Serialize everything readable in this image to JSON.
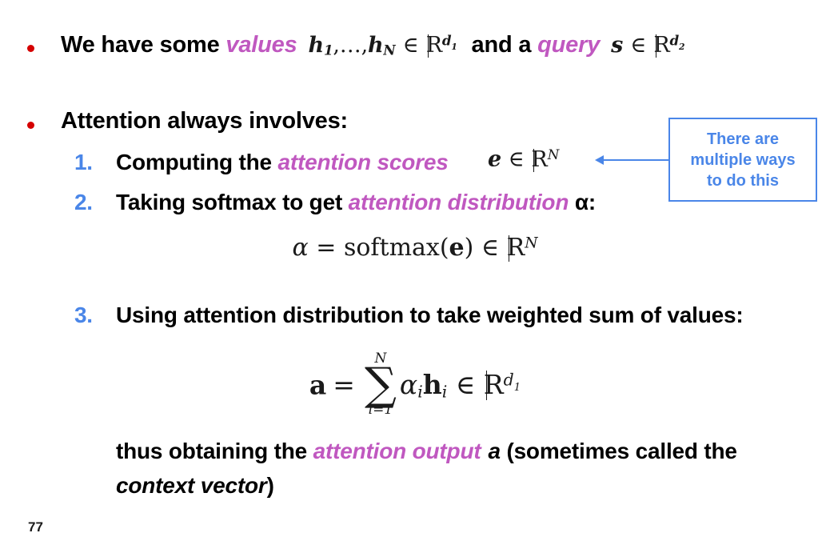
{
  "slide": {
    "page_number": "77",
    "colors": {
      "bullet_red": "#d50000",
      "accent_purple": "#c058c0",
      "accent_blue": "#4a86e8",
      "text_black": "#000000",
      "background": "#ffffff"
    }
  },
  "bullets": [
    {
      "id": "values-query",
      "marker": "•",
      "text_1": "We have some ",
      "emph_1": "values",
      "math_1": "h₁, …, h_N ∈ ℝ^{d₁}",
      "text_2": " and a ",
      "emph_2": "query",
      "math_2": "s ∈ ℝ^{d₂}"
    },
    {
      "id": "attention-involves",
      "marker": "•",
      "text_1": "Attention always involves:"
    }
  ],
  "steps": [
    {
      "number": "1.",
      "text_before": "Computing the ",
      "emph": "attention scores",
      "text_after": "",
      "math_inline": "e ∈ ℝ^N"
    },
    {
      "number": "2.",
      "text_before": "Taking softmax to get ",
      "emph": "attention distribution",
      "text_after": " α:",
      "equation": "α = softmax(e) ∈ ℝ^N"
    },
    {
      "number": "3.",
      "text_before": "Using attention distribution to take weighted sum of values:",
      "emph": "",
      "text_after": "",
      "equation": "a = Σ_{i=1}^{N} α_i h_i ∈ ℝ^{d₁}"
    }
  ],
  "closing": {
    "line1_before": "thus obtaining the ",
    "line1_emph": "attention output",
    "line1_var": "a",
    "line1_after": " (sometimes called the",
    "line2": "context vector",
    "line2_after": ")"
  },
  "callout": {
    "line1": "There are",
    "line2": "multiple ways",
    "line3": "to do this",
    "points_to": "attention-scores-equation"
  },
  "math_literals": {
    "h_sub1": "1",
    "h_subN": "N",
    "ellipsis": ",…,",
    "d1": "d",
    "d1_sub": "1",
    "d2": "d",
    "d2_sub": "2",
    "N": "N",
    "in": "∈",
    "h": "h",
    "s": "s",
    "e": "e",
    "a": "a",
    "alpha": "α",
    "equals": "=",
    "softmax": "softmax",
    "lparen": "(",
    "rparen": ")",
    "sigma": "∑",
    "sum_lower": "i=1",
    "sum_upper": "N",
    "i": "i"
  }
}
